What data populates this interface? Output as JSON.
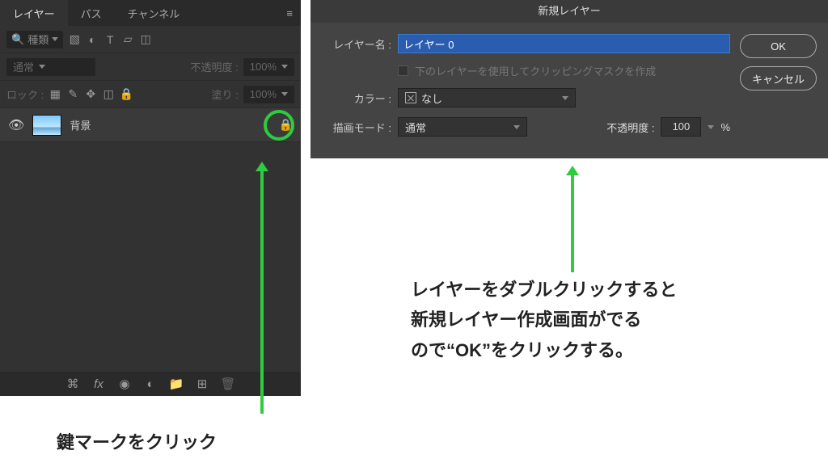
{
  "left_panel": {
    "tabs": {
      "layers": "レイヤー",
      "paths": "パス",
      "channels": "チャンネル"
    },
    "search_placeholder": "種類",
    "blend_mode": "通常",
    "opacity_label": "不透明度 :",
    "opacity_value": "100%",
    "lock_label": "ロック :",
    "fill_label": "塗り :",
    "fill_value": "100%",
    "layer": {
      "name": "背景"
    }
  },
  "dialog": {
    "title": "新規レイヤー",
    "name_label": "レイヤー名 :",
    "name_value": "レイヤー 0",
    "clipping_label": "下のレイヤーを使用してクリッピングマスクを作成",
    "color_label": "カラー :",
    "color_value": "なし",
    "mode_label": "描画モード :",
    "mode_value": "通常",
    "opacity_label": "不透明度 :",
    "opacity_value": "100",
    "opacity_unit": "%",
    "ok": "OK",
    "cancel": "キャンセル"
  },
  "captions": {
    "left": "鍵マークをクリック",
    "right_l1": "レイヤーをダブルクリックすると",
    "right_l2": "新規レイヤー作成画面がでる",
    "right_l3": "ので“OK”をクリックする。"
  }
}
